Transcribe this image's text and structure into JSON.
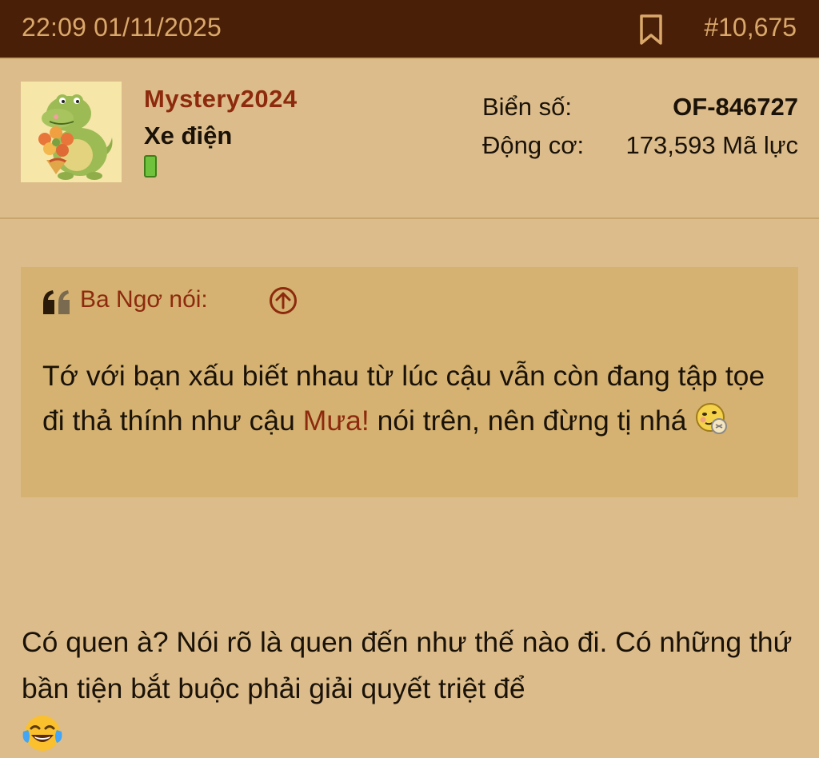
{
  "header": {
    "timestamp": "22:09 01/11/2025",
    "bookmark_icon": "bookmark-icon",
    "post_number": "#10,675"
  },
  "author": {
    "username": "Mystery2024",
    "title": "Xe điện",
    "avatar_icon": "crocodile-with-flowers-avatar",
    "online_status_icon": "online-indicator-icon",
    "stats": [
      {
        "label": "Biển số:",
        "value": "OF-846727"
      },
      {
        "label": "Động cơ:",
        "value": "173,593 Mã lực"
      }
    ]
  },
  "quote": {
    "author": "Ba Ngơ nói:",
    "quote_icon": "quote-marks-icon",
    "jump_icon": "arrow-up-circle-icon",
    "text_part1": "Tớ với bạn xấu biết nhau từ lúc cậu vẫn còn đang tập tọe đi thả thính như cậu ",
    "mention": "Mưa!",
    "text_part2": " nói trên, nên đừng tị nhá ",
    "smiley_icon": "shy-smiley-icon"
  },
  "post": {
    "text": "Có quen à? Nói rõ là quen đến như thế nào đi. Có những thứ bần tiện bắt buộc phải giải quyết triệt để",
    "emoji_icon": "tears-of-joy-emoji-icon"
  },
  "colors": {
    "background": "#dcbc8b",
    "header_bg": "#4a1f08",
    "header_text": "#d9a86a",
    "quote_bg": "#d5b271",
    "accent_red": "#8d2a0d",
    "online_green": "#6ec23c"
  }
}
